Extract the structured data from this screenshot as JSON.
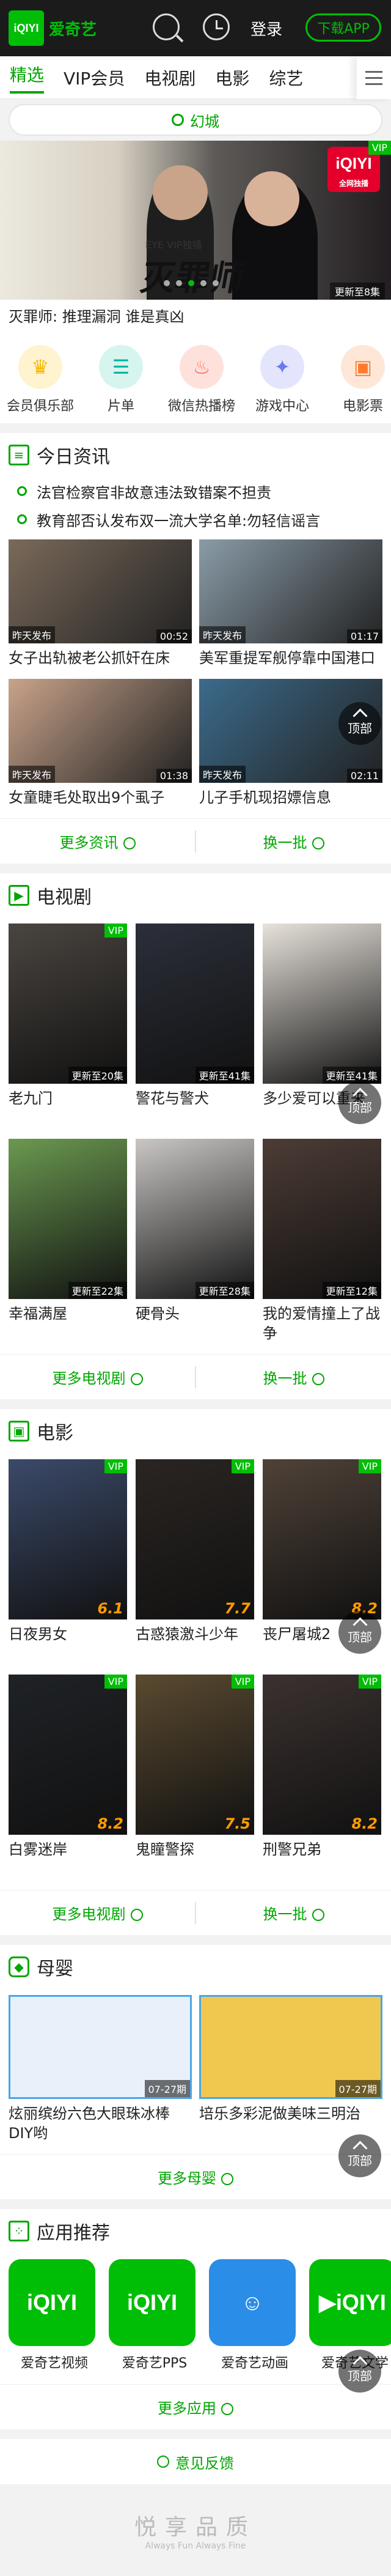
{
  "header": {
    "logo": "iQIYI",
    "app_name": "爱奇艺",
    "login": "登录",
    "download": "下载APP"
  },
  "tabs": [
    "精选",
    "VIP会员",
    "电视剧",
    "电影",
    "综艺"
  ],
  "search": {
    "placeholder": "幻城"
  },
  "banner": {
    "title": "灭罪师",
    "subtitle": "EYE  VIP独播",
    "badge": "iQIYI",
    "badge_sub": "全网独播",
    "vip": "VIP",
    "update": "更新至8集",
    "caption": "灭罪师: 推理漏洞 谁是真凶"
  },
  "quick_links": [
    {
      "label": "会员俱乐部",
      "icon": "crown-icon",
      "color": "#f5b800",
      "bg": "#fff3d0"
    },
    {
      "label": "片单",
      "icon": "list-icon",
      "color": "#00b4a0",
      "bg": "#d7f5ef"
    },
    {
      "label": "微信热播榜",
      "icon": "fire-icon",
      "color": "#ff6655",
      "bg": "#ffe1dc"
    },
    {
      "label": "游戏中心",
      "icon": "gamepad-icon",
      "color": "#6b7ae8",
      "bg": "#e2e5fc"
    },
    {
      "label": "电影票",
      "icon": "ticket-icon",
      "color": "#ff7a2d",
      "bg": "#ffe7d8"
    }
  ],
  "news": {
    "title": "今日资讯",
    "lines": [
      "法官检察官非故意违法致错案不担责",
      "教育部否认发布双一流大学名单:勿轻信谣言"
    ],
    "items": [
      {
        "tag": "昨天发布",
        "time": "00:52",
        "title": "女子出轨被老公抓奸在床",
        "bg": "#7a6a5a"
      },
      {
        "tag": "昨天发布",
        "time": "01:17",
        "title": "美军重提军舰停靠中国港口",
        "bg": "#8a9ca8"
      },
      {
        "tag": "昨天发布",
        "time": "01:38",
        "title": "女童睫毛处取出9个虱子",
        "bg": "#c9a38a"
      },
      {
        "tag": "昨天发布",
        "time": "02:11",
        "title": "儿子手机现招嫖信息",
        "bg": "#3b6b8c"
      }
    ],
    "more": "更多资讯",
    "refresh": "换一批"
  },
  "tv": {
    "title": "电视剧",
    "items": [
      {
        "title": "老九门",
        "update": "更新至20集",
        "vip": "VIP",
        "bg": "#4a4540"
      },
      {
        "title": "警花与警犬",
        "update": "更新至41集",
        "bg": "#2c2f3a"
      },
      {
        "title": "多少爱可以重来",
        "update": "更新至41集",
        "bg": "#e7e2db"
      },
      {
        "title": "幸福满屋",
        "update": "更新至22集",
        "bg": "#6a9950"
      },
      {
        "title": "硬骨头",
        "update": "更新至28集",
        "bg": "#c9c6c4"
      },
      {
        "title": "我的爱情撞上了战争",
        "update": "更新至12集",
        "bg": "#4c3c35"
      }
    ],
    "more": "更多电视剧",
    "refresh": "换一批"
  },
  "movie": {
    "title": "电影",
    "items": [
      {
        "title": "日夜男女",
        "score": "6.1",
        "vip": "VIP",
        "bg": "#3b4a6a"
      },
      {
        "title": "古惑猿激斗少年",
        "score": "7.7",
        "vip": "VIP",
        "bg": "#2a2522"
      },
      {
        "title": "丧尸屠城2",
        "score": "8.2",
        "vip": "VIP",
        "bg": "#4f4238"
      },
      {
        "title": "白雾迷岸",
        "score": "8.2",
        "vip": "VIP",
        "bg": "#1f2226"
      },
      {
        "title": "鬼瞳警探",
        "score": "7.5",
        "vip": "VIP",
        "bg": "#5a4a30"
      },
      {
        "title": "刑警兄弟",
        "score": "8.2",
        "vip": "VIP",
        "bg": "#3b3230"
      }
    ],
    "more": "更多电视剧",
    "refresh": "换一批"
  },
  "baby": {
    "title": "母婴",
    "items": [
      {
        "title": "炫丽缤纷六色大眼珠冰棒DIY哟",
        "date": "07-27期",
        "bg": "#e8f0fa"
      },
      {
        "title": "培乐多彩泥做美味三明治",
        "date": "07-27期",
        "bg": "#f0c850"
      }
    ],
    "more": "更多母婴"
  },
  "apps": {
    "title": "应用推荐",
    "items": [
      {
        "name": "爱奇艺视频",
        "label": "iQIYI",
        "bg": "#00be06"
      },
      {
        "name": "爱奇艺PPS",
        "label": "iQIYI",
        "bg": "#00be06"
      },
      {
        "name": "爱奇艺动画",
        "label": "☺",
        "bg": "#2a8de8"
      },
      {
        "name": "爱奇艺文学",
        "label": "▶iQIYI",
        "bg": "#00be06"
      }
    ],
    "more": "更多应用"
  },
  "feedback": "意见反馈",
  "footer": {
    "slogan": "悦享品质",
    "slogan_en": "Always Fun Always Fine"
  },
  "float": {
    "top": "顶部"
  }
}
